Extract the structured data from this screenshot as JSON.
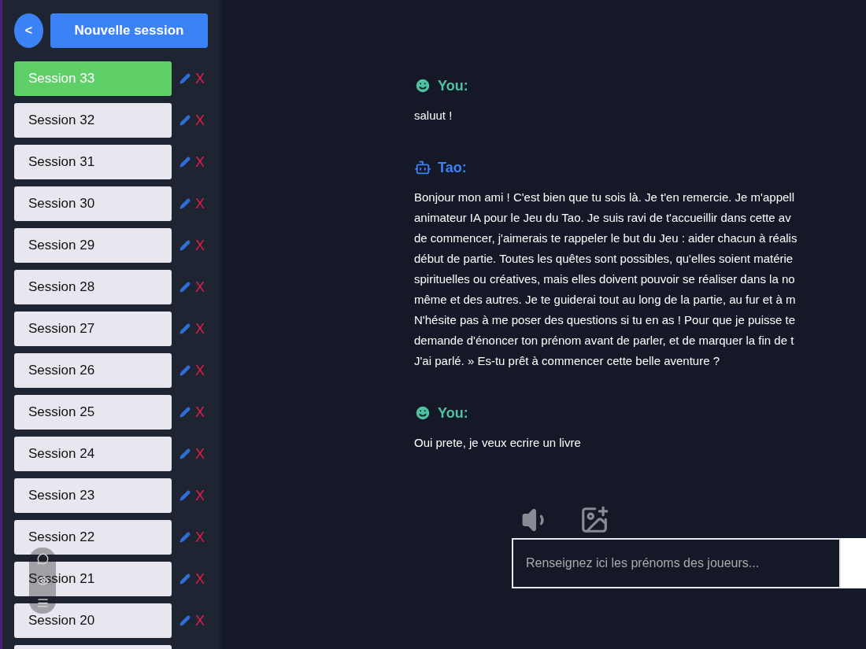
{
  "sidebar": {
    "back_button": "<",
    "new_session_button": "Nouvelle session",
    "sessions": [
      {
        "label": "Session 33",
        "selected": true,
        "delete": "X"
      },
      {
        "label": "Session 32",
        "selected": false,
        "delete": "X"
      },
      {
        "label": "Session 31",
        "selected": false,
        "delete": "X"
      },
      {
        "label": "Session 30",
        "selected": false,
        "delete": "X"
      },
      {
        "label": "Session 29",
        "selected": false,
        "delete": "X"
      },
      {
        "label": "Session 28",
        "selected": false,
        "delete": "X"
      },
      {
        "label": "Session 27",
        "selected": false,
        "delete": "X"
      },
      {
        "label": "Session 26",
        "selected": false,
        "delete": "X"
      },
      {
        "label": "Session 25",
        "selected": false,
        "delete": "X"
      },
      {
        "label": "Session 24",
        "selected": false,
        "delete": "X"
      },
      {
        "label": "Session 23",
        "selected": false,
        "delete": "X"
      },
      {
        "label": "Session 22",
        "selected": false,
        "delete": "X"
      },
      {
        "label": "Session 21",
        "selected": false,
        "delete": "X"
      },
      {
        "label": "Session 20",
        "selected": false,
        "delete": "X"
      },
      {
        "selected": false
      }
    ]
  },
  "messages": [
    {
      "kind": "user",
      "author": "You:",
      "lines": [
        "saluut !"
      ]
    },
    {
      "kind": "bot",
      "author": "Tao:",
      "lines": [
        "Bonjour mon ami ! C'est bien que tu sois là. Je t'en remercie. Je m'appell",
        "animateur IA pour le Jeu du Tao. Je suis ravi de t'accueillir dans cette av",
        "de commencer, j'aimerais te rappeler le but du Jeu : aider chacun à réalis",
        "début de partie. Toutes les quêtes sont possibles, qu'elles soient matérie",
        "spirituelles ou créatives, mais elles doivent pouvoir se réaliser dans la no",
        "même et des autres. Je te guiderai tout au long de la partie, au fur et à m",
        "N'hésite pas à me poser des questions si tu en as ! Pour que je puisse te",
        "demande d'énoncer ton prénom avant de parler, et de marquer la fin de t",
        "J'ai parlé. » Es-tu prêt à commencer cette belle aventure ?"
      ]
    },
    {
      "kind": "user",
      "author": "You:",
      "lines": [
        "Oui prete, je veux ecrire un livre"
      ]
    }
  ],
  "input": {
    "placeholder": "Renseignez ici les prénoms des joueurs..."
  }
}
